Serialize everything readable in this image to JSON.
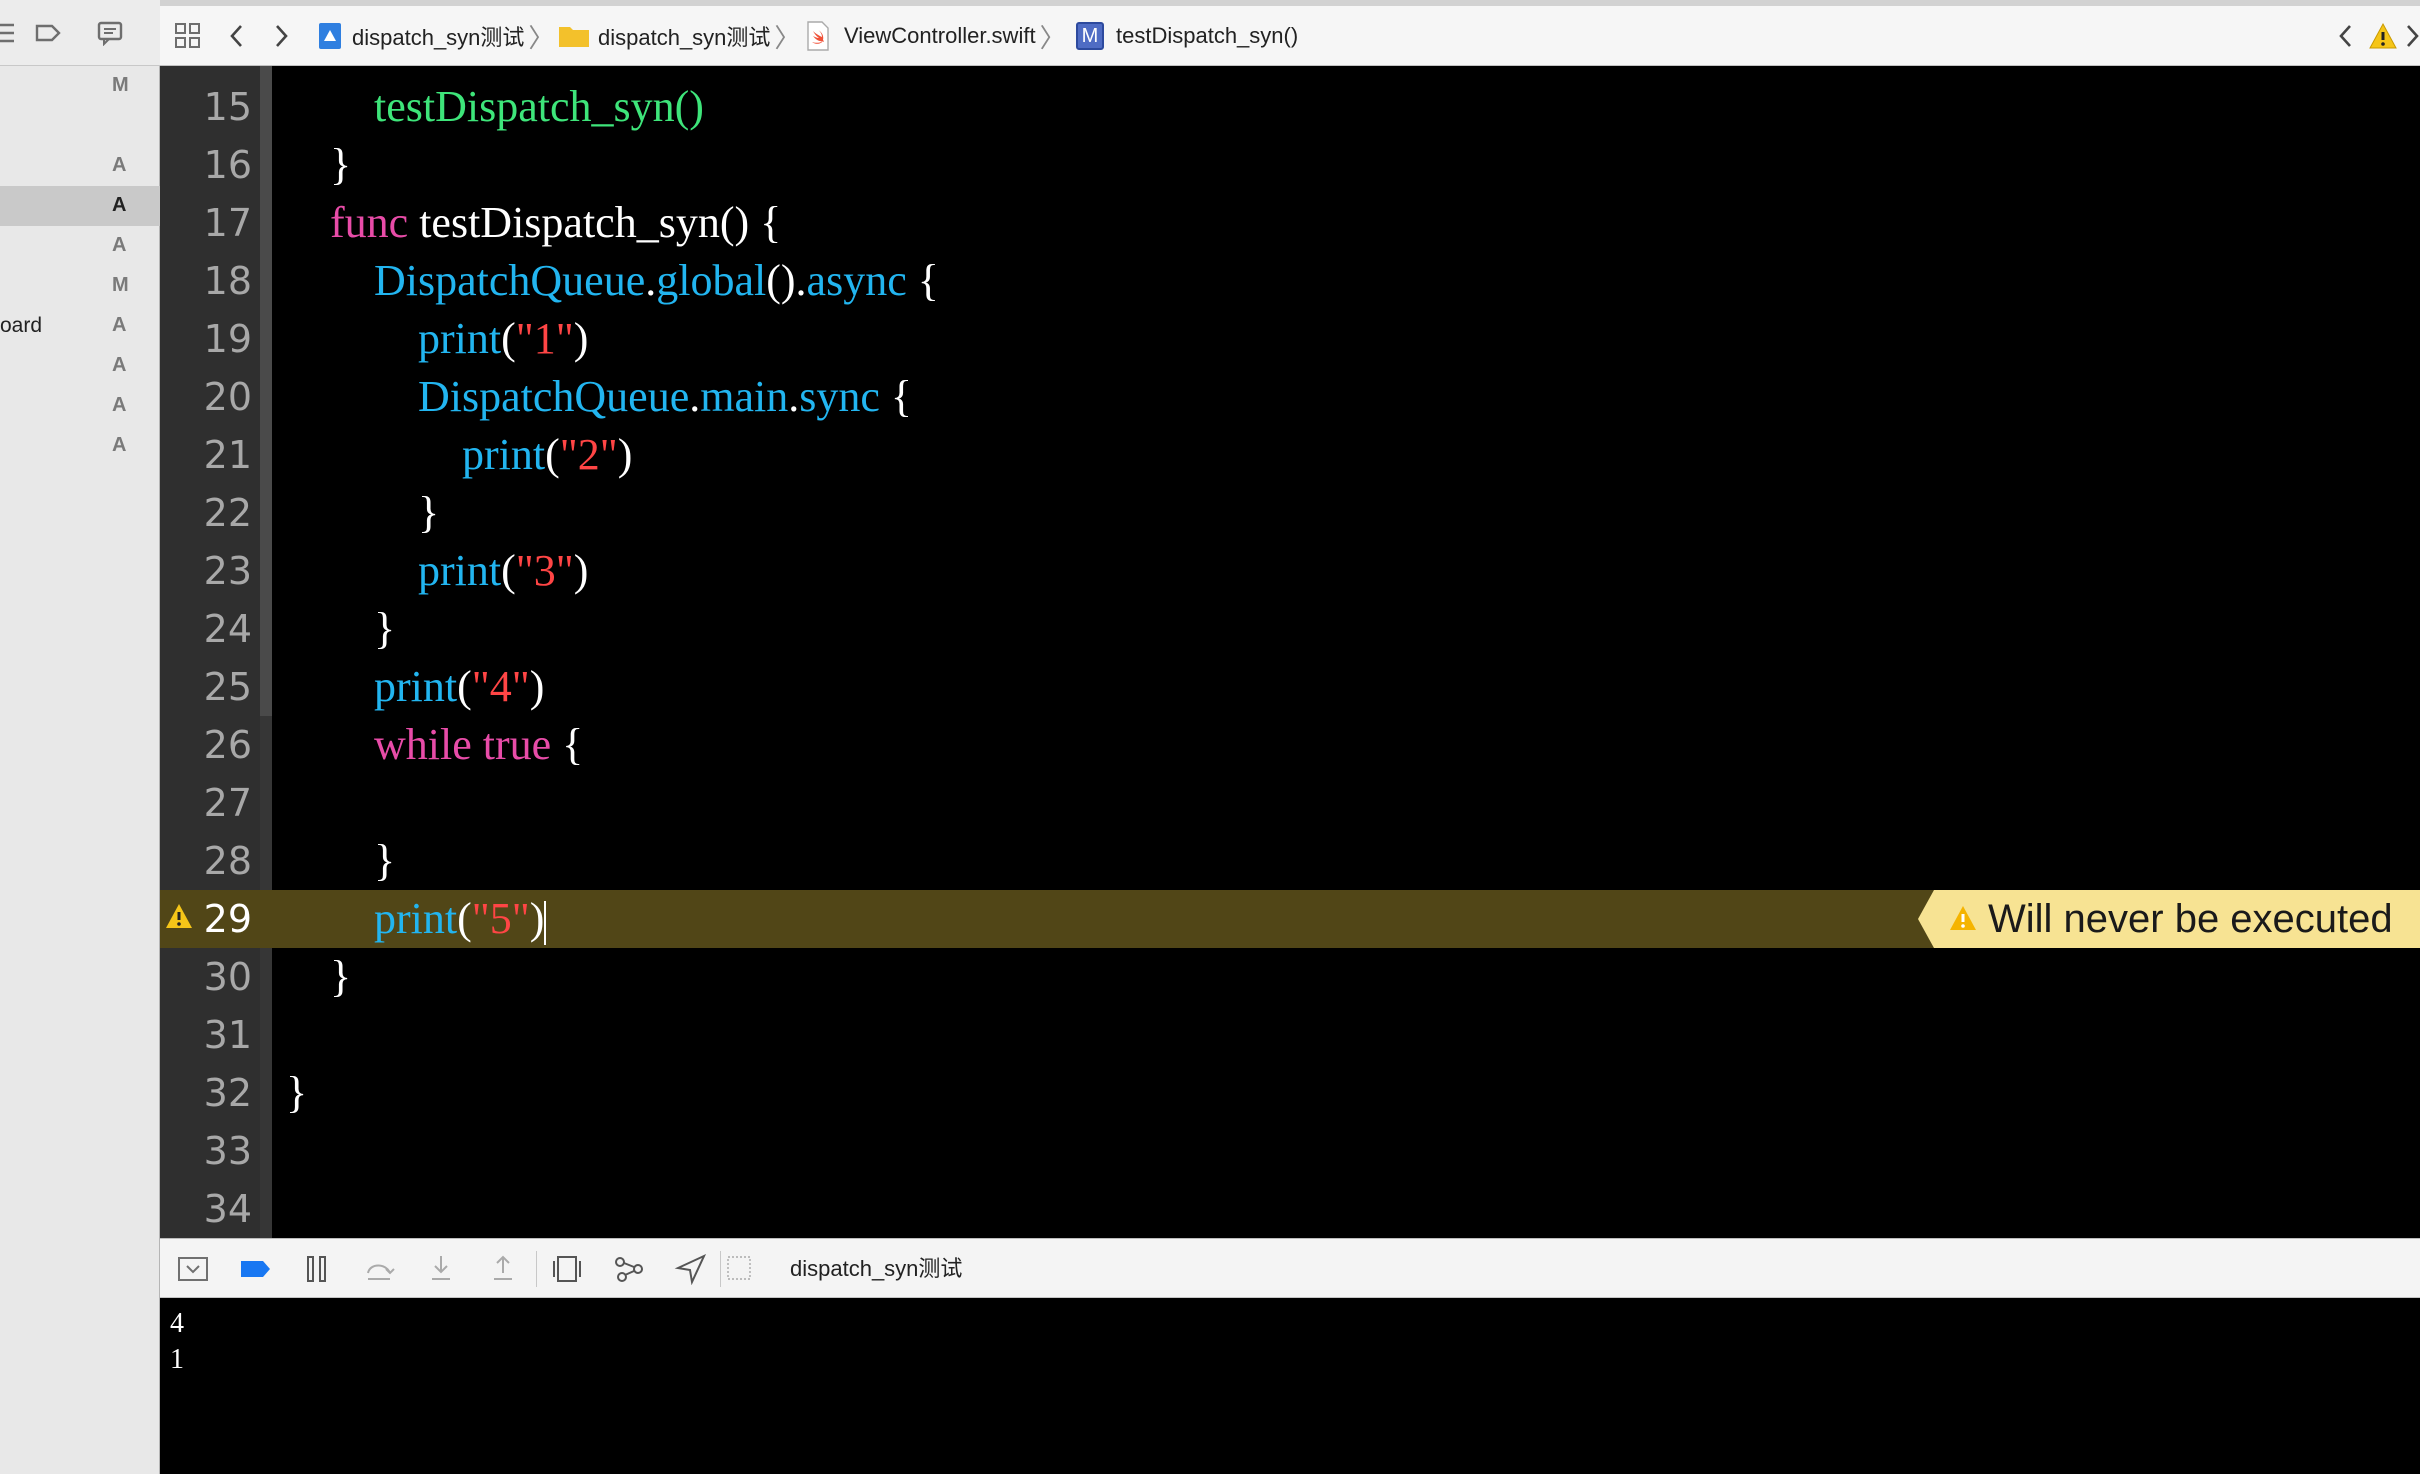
{
  "nav": {
    "files": [
      {
        "name": "",
        "status": "M"
      },
      {
        "name": "",
        "status": "A"
      },
      {
        "name": "",
        "status": "A"
      },
      {
        "name": "",
        "status": "A"
      },
      {
        "name": "",
        "status": "M"
      },
      {
        "name": "oard",
        "status": "A"
      },
      {
        "name": "",
        "status": "A"
      },
      {
        "name": "",
        "status": "A"
      },
      {
        "name": "",
        "status": "A"
      }
    ]
  },
  "jumpbar": {
    "project": "dispatch_syn测试",
    "group": "dispatch_syn测试",
    "file": "ViewController.swift",
    "method_badge": "M",
    "method": "testDispatch_syn()"
  },
  "editor": {
    "lines": [
      {
        "n": "15"
      },
      {
        "n": "16"
      },
      {
        "n": "17"
      },
      {
        "n": "18"
      },
      {
        "n": "19"
      },
      {
        "n": "20"
      },
      {
        "n": "21"
      },
      {
        "n": "22"
      },
      {
        "n": "23"
      },
      {
        "n": "24"
      },
      {
        "n": "25"
      },
      {
        "n": "26"
      },
      {
        "n": "27"
      },
      {
        "n": "28"
      },
      {
        "n": "29"
      },
      {
        "n": "30"
      },
      {
        "n": "31"
      },
      {
        "n": "32"
      },
      {
        "n": "33"
      },
      {
        "n": "34"
      }
    ],
    "code": {
      "l15": "testDispatch_syn()",
      "l16": "}",
      "l17_kw": "func",
      "l17_rest": " testDispatch_syn() {",
      "l18_a": "DispatchQueue",
      "l18_b": ".",
      "l18_c": "global",
      "l18_d": "().",
      "l18_e": "async",
      "l18_f": " {",
      "print": "print",
      "open": "(",
      "close": ")",
      "s1": "\"1\"",
      "s2": "\"2\"",
      "s3": "\"3\"",
      "s4": "\"4\"",
      "s5": "\"5\"",
      "l20_a": "DispatchQueue",
      "l20_b": ".",
      "l20_c": "main",
      "l20_d": ".",
      "l20_e": "sync",
      "l20_f": " {",
      "brace": "}",
      "l26_kw1": "while",
      "l26_kw2": "true",
      "l26_rest": " {"
    },
    "warning": {
      "line": "29",
      "message": "Will never be executed",
      "color": "#f7e393"
    },
    "colors": {
      "keyword": "#e84ca8",
      "function": "#22b5f0",
      "string": "#ff4545",
      "call": "#3ee57a"
    }
  },
  "debugbar": {
    "target": "dispatch_syn测试"
  },
  "console": {
    "lines": [
      "4",
      "1"
    ]
  }
}
